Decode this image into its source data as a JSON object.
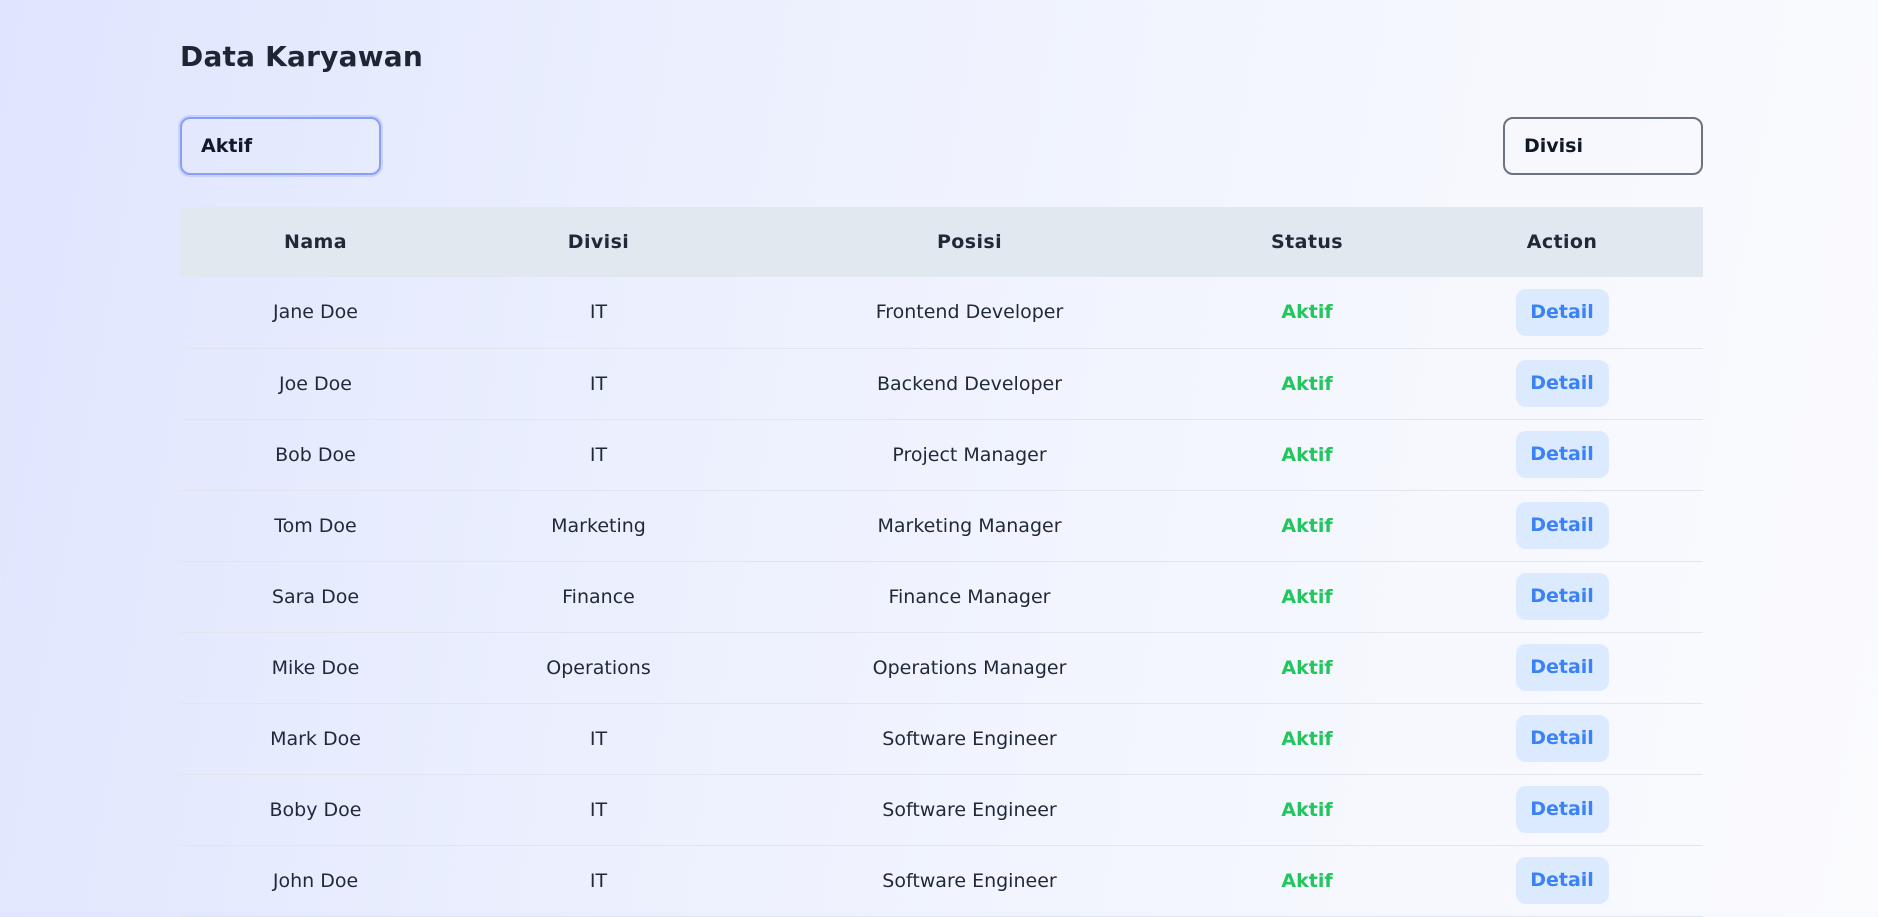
{
  "page": {
    "title": "Data Karyawan"
  },
  "filters": {
    "status_value": "Aktif",
    "divisi_value": "Divisi"
  },
  "table": {
    "headers": [
      "Nama",
      "Divisi",
      "Posisi",
      "Status",
      "Action"
    ],
    "rows": [
      {
        "nama": "Jane Doe",
        "divisi": "IT",
        "posisi": "Frontend Developer",
        "status": "Aktif",
        "action": "Detail"
      },
      {
        "nama": "Joe Doe",
        "divisi": "IT",
        "posisi": "Backend Developer",
        "status": "Aktif",
        "action": "Detail"
      },
      {
        "nama": "Bob Doe",
        "divisi": "IT",
        "posisi": "Project Manager",
        "status": "Aktif",
        "action": "Detail"
      },
      {
        "nama": "Tom Doe",
        "divisi": "Marketing",
        "posisi": "Marketing Manager",
        "status": "Aktif",
        "action": "Detail"
      },
      {
        "nama": "Sara Doe",
        "divisi": "Finance",
        "posisi": "Finance Manager",
        "status": "Aktif",
        "action": "Detail"
      },
      {
        "nama": "Mike Doe",
        "divisi": "Operations",
        "posisi": "Operations Manager",
        "status": "Aktif",
        "action": "Detail"
      },
      {
        "nama": "Mark Doe",
        "divisi": "IT",
        "posisi": "Software Engineer",
        "status": "Aktif",
        "action": "Detail"
      },
      {
        "nama": "Boby Doe",
        "divisi": "IT",
        "posisi": "Software Engineer",
        "status": "Aktif",
        "action": "Detail"
      },
      {
        "nama": "John Doe",
        "divisi": "IT",
        "posisi": "Software Engineer",
        "status": "Aktif",
        "action": "Detail"
      }
    ]
  },
  "colors": {
    "status_active": "#22c55e",
    "detail_button_bg": "#dbeafe",
    "detail_button_text": "#3b82f6",
    "header_bg": "#e2e8f0",
    "focus_ring": "#8b9ff0"
  }
}
